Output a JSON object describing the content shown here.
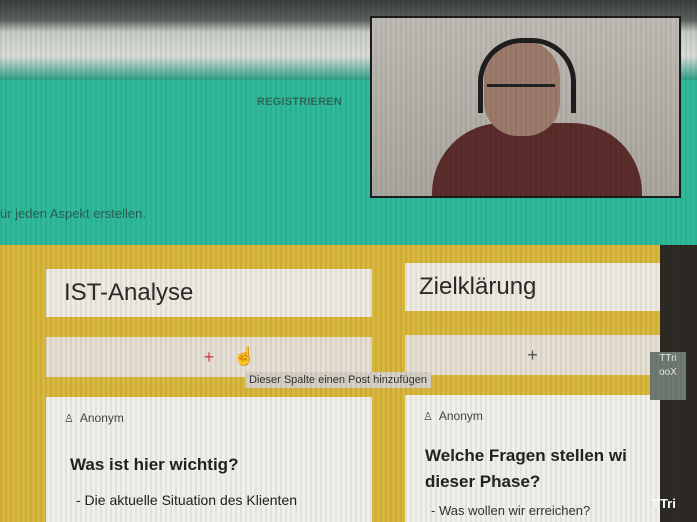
{
  "header": {
    "register_label": "REGISTRIEREN",
    "instruction": "ür jeden Aspekt erstellen."
  },
  "columns": [
    {
      "title": "IST-Analyse",
      "add_symbol": "+",
      "card": {
        "author": "Anonym",
        "title": "Was ist hier wichtig?",
        "text": "- Die aktuelle Situation des  Klienten"
      }
    },
    {
      "title": "Zielklärung",
      "add_symbol": "+",
      "card": {
        "author": "Anonym",
        "title": "Welche Fragen stellen wi dieser Phase?",
        "text": "- Was wollen wir erreichen?"
      }
    }
  ],
  "tooltip": "Dieser Spalte einen Post hinzufügen",
  "side_button_text": "TTri ooX",
  "side_text_bottom": "TTri",
  "icons": {
    "cursor": "hand-pointer-icon",
    "author": "user-icon"
  },
  "colors": {
    "header_teal": "#2fb99b",
    "board_yellow": "#d8b73b",
    "card_bg": "#f1efe9"
  }
}
